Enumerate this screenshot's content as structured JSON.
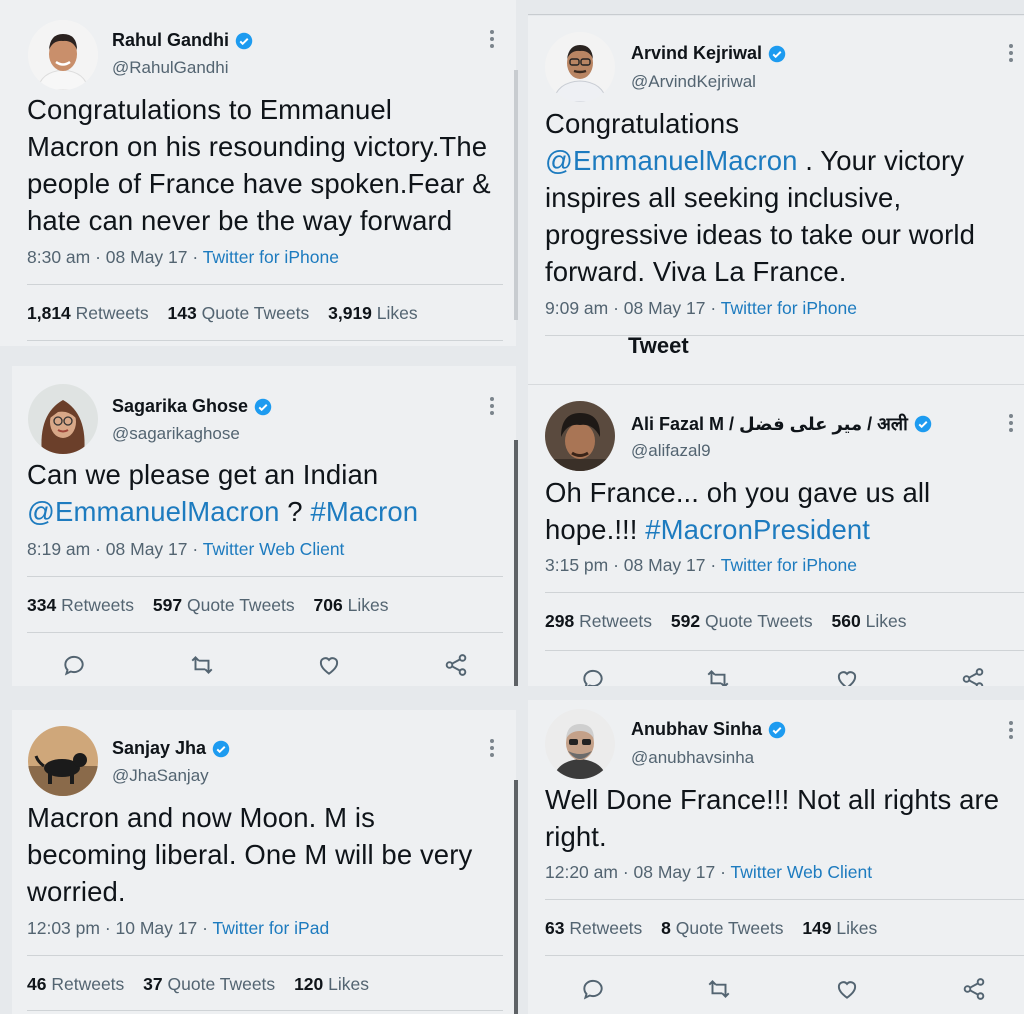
{
  "tweets": [
    {
      "name": "Rahul Gandhi",
      "handle": "@RahulGandhi",
      "text_lines": [
        "Congratulations to Emmanuel",
        "Macron on his resounding victory.The",
        "people of France have spoken.Fear &",
        "hate can never be the way forward"
      ],
      "time": "8:30 am · 08 May 17 · ",
      "source": "Twitter for iPhone",
      "retweets": "1,814",
      "retweets_label": "Retweets",
      "quotes": "143",
      "quotes_label": "Quote Tweets",
      "likes": "3,919",
      "likes_label": "Likes"
    },
    {
      "name": "Arvind Kejriwal",
      "handle": "@ArvindKejriwal",
      "line1": "Congratulations",
      "mention": "@EmmanuelMacron",
      "line2_rest": " . Your victory",
      "text_lines": [
        "inspires all seeking inclusive,",
        "progressive ideas to take our world",
        "forward. Viva La France."
      ],
      "time": "9:09 am · 08 May 17 · ",
      "source": "Twitter for iPhone",
      "fragment": "Tweet"
    },
    {
      "name": "Sagarika Ghose",
      "handle": "@sagarikaghose",
      "line1": "Can we please get an Indian",
      "mention": "@EmmanuelMacron",
      "mid": " ? ",
      "hashtag": "#Macron",
      "time": "8:19 am · 08 May 17 · ",
      "source": "Twitter Web Client",
      "retweets": "334",
      "retweets_label": "Retweets",
      "quotes": "597",
      "quotes_label": "Quote Tweets",
      "likes": "706",
      "likes_label": "Likes"
    },
    {
      "name": "Ali Fazal M / میر علی فضل / अली",
      "handle": "@alifazal9",
      "line1": "Oh France... oh you gave us all",
      "line2_pre": "hope.!!! ",
      "hashtag": "#MacronPresident",
      "time": "3:15 pm · 08 May 17 · ",
      "source": "Twitter for iPhone",
      "retweets": "298",
      "retweets_label": "Retweets",
      "quotes": "592",
      "quotes_label": "Quote Tweets",
      "likes": "560",
      "likes_label": "Likes"
    },
    {
      "name": "Sanjay Jha",
      "handle": "@JhaSanjay",
      "text_lines": [
        "Macron and now Moon. M is",
        "becoming liberal. One M will be very",
        "worried."
      ],
      "time": "12:03 pm · 10 May 17 · ",
      "source": "Twitter for iPad",
      "retweets": "46",
      "retweets_label": "Retweets",
      "quotes": "37",
      "quotes_label": "Quote Tweets",
      "likes": "120",
      "likes_label": "Likes"
    },
    {
      "name": "Anubhav Sinha",
      "handle": "@anubhavsinha",
      "text_lines": [
        "Well Done France!!! Not all rights are",
        "right."
      ],
      "time": "12:20 am · 08 May 17 · ",
      "source": "Twitter Web Client",
      "retweets": "63",
      "retweets_label": "Retweets",
      "quotes": "8",
      "quotes_label": "Quote Tweets",
      "likes": "149",
      "likes_label": "Likes"
    }
  ],
  "colors": {
    "link": "#1d7bbf",
    "verified": "#1d9bf0",
    "muted": "#536471"
  },
  "icons": [
    "reply-icon",
    "retweet-icon",
    "like-icon",
    "share-icon",
    "verified-badge-icon",
    "more-icon"
  ]
}
